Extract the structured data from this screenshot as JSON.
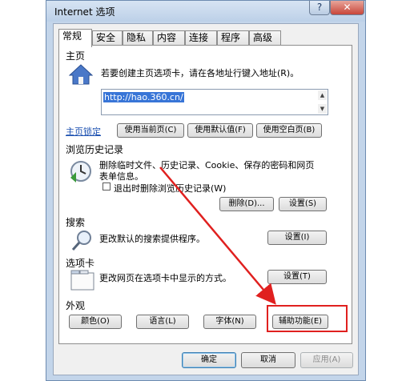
{
  "window": {
    "title": "Internet 选项",
    "help": "?",
    "close": "✕"
  },
  "tabs": [
    "常规",
    "安全",
    "隐私",
    "内容",
    "连接",
    "程序",
    "高级"
  ],
  "home": {
    "section": "主页",
    "desc": "若要创建主页选项卡，请在各地址行键入地址(R)。",
    "url": "http://hao.360.cn/",
    "lock": "主页锁定",
    "use_current": "使用当前页(C)",
    "use_default": "使用默认值(F)",
    "use_blank": "使用空白页(B)"
  },
  "history": {
    "section": "浏览历史记录",
    "desc_line1": "删除临时文件、历史记录、Cookie、保存的密码和网页",
    "desc_line2": "表单信息。",
    "checkbox_label": "退出时删除浏览历史记录(W)",
    "delete": "删除(D)...",
    "settings": "设置(S)"
  },
  "search": {
    "section": "搜索",
    "desc": "更改默认的搜索提供程序。",
    "settings": "设置(I)"
  },
  "tabs_section": {
    "section": "选项卡",
    "desc": "更改网页在选项卡中显示的方式。",
    "settings": "设置(T)"
  },
  "appearance": {
    "section": "外观",
    "colors": "颜色(O)",
    "languages": "语言(L)",
    "fonts": "字体(N)",
    "accessibility": "辅助功能(E)"
  },
  "footer": {
    "ok": "确定",
    "cancel": "取消",
    "apply": "应用(A)"
  },
  "annotation_color": "#e0201f"
}
